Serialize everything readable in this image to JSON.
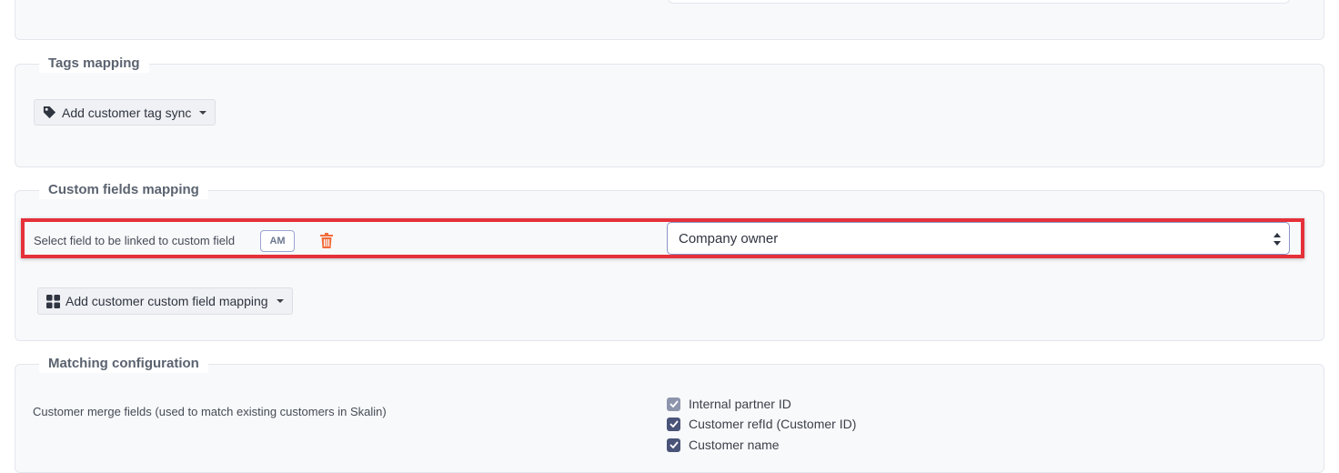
{
  "tags_section": {
    "legend": "Tags mapping",
    "add_button_label": "Add customer tag sync"
  },
  "custom_fields_section": {
    "legend": "Custom fields mapping",
    "row_label": "Select field to be linked to custom field",
    "badge": "AM",
    "selected_field": "Company owner",
    "add_button_label": "Add customer custom field mapping",
    "highlight_color": "#e5313a"
  },
  "matching_section": {
    "legend": "Matching configuration",
    "merge_fields_label": "Customer merge fields (used to match existing customers in Skalin)",
    "merge_fields": [
      {
        "label": "Internal partner ID",
        "checked": true,
        "disabled": true
      },
      {
        "label": "Customer refId (Customer ID)",
        "checked": true,
        "disabled": false
      },
      {
        "label": "Customer name",
        "checked": true,
        "disabled": false
      }
    ]
  },
  "colors": {
    "accent": "#4a5478",
    "danger": "#f26b3a",
    "panel_bg": "#f8f9fb"
  }
}
